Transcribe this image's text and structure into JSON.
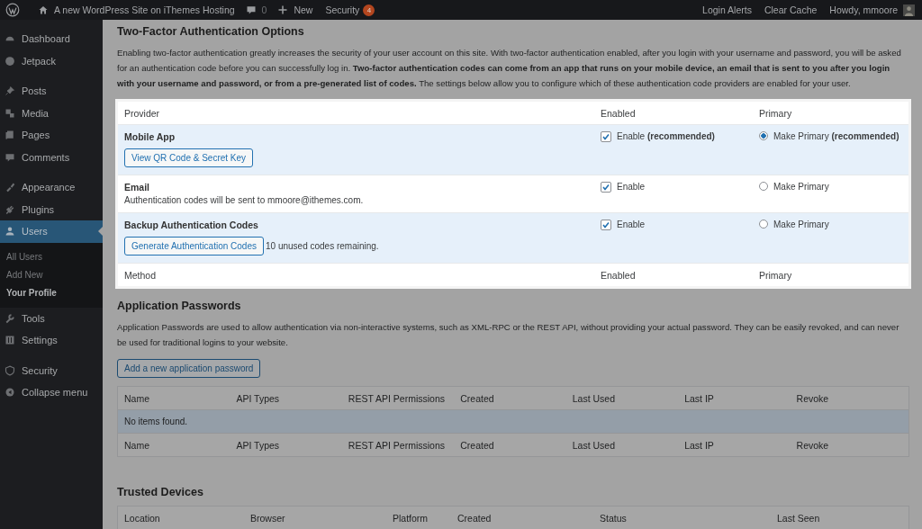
{
  "admin_bar": {
    "site_title": "A new WordPress Site on iThemes Hosting",
    "comments_count": "0",
    "new_label": "New",
    "security": {
      "label": "Security",
      "badge": "4"
    },
    "right_links": [
      "Login Alerts",
      "Clear Cache"
    ],
    "howdy": "Howdy, mmoore"
  },
  "sidebar": {
    "groups": [
      [
        {
          "label": "Dashboard",
          "selected": false
        },
        {
          "label": "Jetpack",
          "selected": false
        }
      ],
      [
        {
          "label": "Posts",
          "selected": false
        },
        {
          "label": "Media",
          "selected": false
        },
        {
          "label": "Pages",
          "selected": false
        },
        {
          "label": "Comments",
          "selected": false
        }
      ],
      [
        {
          "label": "Appearance",
          "selected": false
        },
        {
          "label": "Plugins",
          "selected": false
        },
        {
          "label": "Users",
          "selected": true,
          "children": [
            {
              "label": "All Users",
              "selected": false
            },
            {
              "label": "Add New",
              "selected": false
            },
            {
              "label": "Your Profile",
              "selected": true
            }
          ]
        },
        {
          "label": "Tools",
          "selected": false
        },
        {
          "label": "Settings",
          "selected": false
        }
      ],
      [
        {
          "label": "Security",
          "selected": false
        },
        {
          "label": "Collapse menu",
          "selected": false
        }
      ]
    ]
  },
  "two_factor": {
    "title": "Two-Factor Authentication Options",
    "intro": "Enabling two-factor authentication greatly increases the security of your user account on this site. With two-factor authentication enabled, after you login with your username and password, you will be asked for an authentication code before you can successfully log in. **Two-factor authentication codes can come from an app that runs on your mobile device, an email that is sent to you after you login with your username and password, or from a pre-generated list of codes.** The settings below allow you to configure which of these authentication code providers are enabled for your user.",
    "columns": [
      "Provider",
      "Enabled",
      "Primary"
    ],
    "providers": [
      {
        "name": "Mobile App",
        "button": "View QR Code & Secret Key",
        "enable_label": "Enable **(recommended)**",
        "enabled": true,
        "primary_label": "Make Primary **(recommended)**",
        "selected": true
      },
      {
        "name": "Email",
        "description": "Authentication codes will be sent to mmoore@ithemes.com.",
        "enable_label": "Enable",
        "enabled": true,
        "primary_label": "Make Primary",
        "selected": false
      },
      {
        "name": "Backup Authentication Codes",
        "button": "Generate Authentication Codes",
        "note": "10 unused codes remaining.",
        "enable_label": "Enable",
        "enabled": true,
        "primary_label": "Make Primary",
        "selected": false
      }
    ],
    "footer_columns": [
      "Method",
      "Enabled",
      "Primary"
    ]
  },
  "app_passwords": {
    "title": "Application Passwords",
    "description": "Application Passwords are used to allow authentication via non-interactive systems, such as XML-RPC or the REST API, without providing your actual password. They can be easily revoked, and can never be used for traditional logins to your website.",
    "button": "Add a new application password",
    "columns": [
      "Name",
      "API Types",
      "REST API Permissions",
      "Created",
      "Last Used",
      "Last IP",
      "Revoke"
    ],
    "empty": "No items found.",
    "footer_columns": [
      "Name",
      "API Types",
      "REST API Permissions",
      "Created",
      "Last Used",
      "Last IP",
      "Revoke"
    ]
  },
  "trusted_devices": {
    "title": "Trusted Devices",
    "columns": [
      "Location",
      "Browser",
      "Platform",
      "Created",
      "Status",
      "Last Seen"
    ]
  }
}
